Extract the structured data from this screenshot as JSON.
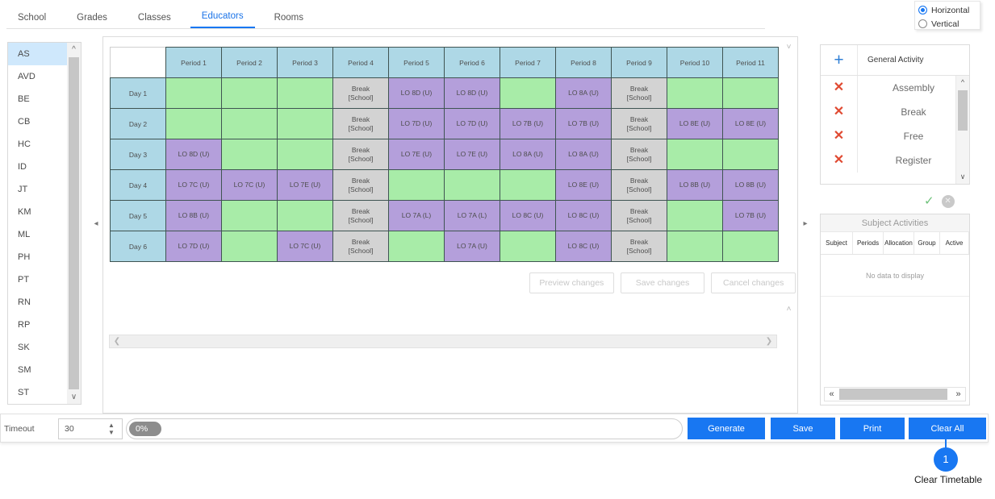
{
  "tabs": [
    {
      "label": "School",
      "active": false
    },
    {
      "label": "Grades",
      "active": false
    },
    {
      "label": "Classes",
      "active": false
    },
    {
      "label": "Educators",
      "active": true
    },
    {
      "label": "Rooms",
      "active": false
    }
  ],
  "orientation": {
    "options": [
      {
        "label": "Horizontal",
        "checked": true
      },
      {
        "label": "Vertical",
        "checked": false
      }
    ]
  },
  "educators": {
    "items": [
      "AS",
      "AVD",
      "BE",
      "CB",
      "HC",
      "ID",
      "JT",
      "KM",
      "ML",
      "PH",
      "PT",
      "RN",
      "RP",
      "SK",
      "SM",
      "ST"
    ],
    "selected": "AS"
  },
  "timetable": {
    "corner_label": "",
    "periods": [
      "Period 1",
      "Period 2",
      "Period 3",
      "Period 4",
      "Period 5",
      "Period 6",
      "Period 7",
      "Period 8",
      "Period 9",
      "Period 10",
      "Period 11"
    ],
    "days": [
      "Day 1",
      "Day 2",
      "Day 3",
      "Day 4",
      "Day 5",
      "Day 6"
    ],
    "break_line1": "Break",
    "break_line2": "[School]",
    "rows": [
      [
        {
          "text": "",
          "type": "free"
        },
        {
          "text": "",
          "type": "free"
        },
        {
          "text": "",
          "type": "free"
        },
        {
          "text": "Break|[School]",
          "type": "break"
        },
        {
          "text": "LO 8D (U)",
          "type": "lesson"
        },
        {
          "text": "LO 8D (U)",
          "type": "lesson"
        },
        {
          "text": "",
          "type": "free"
        },
        {
          "text": "LO 8A (U)",
          "type": "lesson"
        },
        {
          "text": "Break|[School]",
          "type": "break"
        },
        {
          "text": "",
          "type": "free"
        },
        {
          "text": "",
          "type": "free"
        }
      ],
      [
        {
          "text": "",
          "type": "free"
        },
        {
          "text": "",
          "type": "free"
        },
        {
          "text": "",
          "type": "free"
        },
        {
          "text": "Break|[School]",
          "type": "break"
        },
        {
          "text": "LO 7D (U)",
          "type": "lesson"
        },
        {
          "text": "LO 7D (U)",
          "type": "lesson"
        },
        {
          "text": "LO 7B (U)",
          "type": "lesson"
        },
        {
          "text": "LO 7B (U)",
          "type": "lesson"
        },
        {
          "text": "Break|[School]",
          "type": "break"
        },
        {
          "text": "LO 8E (U)",
          "type": "lesson"
        },
        {
          "text": "LO 8E (U)",
          "type": "lesson"
        }
      ],
      [
        {
          "text": "LO 8D (U)",
          "type": "lesson"
        },
        {
          "text": "",
          "type": "free"
        },
        {
          "text": "",
          "type": "free"
        },
        {
          "text": "Break|[School]",
          "type": "break"
        },
        {
          "text": "LO 7E (U)",
          "type": "lesson"
        },
        {
          "text": "LO 7E (U)",
          "type": "lesson"
        },
        {
          "text": "LO 8A (U)",
          "type": "lesson"
        },
        {
          "text": "LO 8A (U)",
          "type": "lesson"
        },
        {
          "text": "Break|[School]",
          "type": "break"
        },
        {
          "text": "",
          "type": "free"
        },
        {
          "text": "",
          "type": "free"
        }
      ],
      [
        {
          "text": "LO 7C (U)",
          "type": "lesson"
        },
        {
          "text": "LO 7C (U)",
          "type": "lesson"
        },
        {
          "text": "LO 7E (U)",
          "type": "lesson"
        },
        {
          "text": "Break|[School]",
          "type": "break"
        },
        {
          "text": "",
          "type": "free"
        },
        {
          "text": "",
          "type": "free"
        },
        {
          "text": "",
          "type": "free"
        },
        {
          "text": "LO 8E (U)",
          "type": "lesson"
        },
        {
          "text": "Break|[School]",
          "type": "break"
        },
        {
          "text": "LO 8B (U)",
          "type": "lesson"
        },
        {
          "text": "LO 8B (U)",
          "type": "lesson"
        }
      ],
      [
        {
          "text": "LO 8B (U)",
          "type": "lesson"
        },
        {
          "text": "",
          "type": "free"
        },
        {
          "text": "",
          "type": "free"
        },
        {
          "text": "Break|[School]",
          "type": "break"
        },
        {
          "text": "LO 7A (L)",
          "type": "lesson"
        },
        {
          "text": "LO 7A (L)",
          "type": "lesson"
        },
        {
          "text": "LO 8C (U)",
          "type": "lesson"
        },
        {
          "text": "LO 8C (U)",
          "type": "lesson"
        },
        {
          "text": "Break|[School]",
          "type": "break"
        },
        {
          "text": "",
          "type": "free"
        },
        {
          "text": "LO 7B (U)",
          "type": "lesson"
        }
      ],
      [
        {
          "text": "LO 7D (U)",
          "type": "lesson"
        },
        {
          "text": "",
          "type": "free"
        },
        {
          "text": "LO 7C (U)",
          "type": "lesson"
        },
        {
          "text": "Break|[School]",
          "type": "break"
        },
        {
          "text": "",
          "type": "free"
        },
        {
          "text": "LO 7A (U)",
          "type": "lesson"
        },
        {
          "text": "",
          "type": "free"
        },
        {
          "text": "LO 8C (U)",
          "type": "lesson"
        },
        {
          "text": "Break|[School]",
          "type": "break"
        },
        {
          "text": "",
          "type": "free"
        },
        {
          "text": "",
          "type": "free"
        }
      ]
    ]
  },
  "change_buttons": [
    {
      "label": "Preview changes"
    },
    {
      "label": "Save changes"
    },
    {
      "label": "Cancel changes"
    }
  ],
  "general_activity": {
    "title": "General Activity",
    "add_icon": "+",
    "remove_icon": "✕",
    "items": [
      "Assembly",
      "Break",
      "Free",
      "Register"
    ],
    "confirm_icon": "✓",
    "cancel_icon": "✕"
  },
  "subject_activities": {
    "title": "Subject Activities",
    "columns": [
      "Subject",
      "Periods",
      "Allocation",
      "Group",
      "Active"
    ],
    "empty_text": "No data to display"
  },
  "bottom": {
    "timeout_label": "Timeout",
    "timeout_value": "30",
    "progress_text": "0%",
    "buttons": [
      {
        "label": "Generate"
      },
      {
        "label": "Save"
      },
      {
        "label": "Print"
      },
      {
        "label": "Clear All"
      }
    ]
  },
  "callout": {
    "number": "1",
    "label": "Clear Timetable"
  },
  "colors": {
    "accent": "#1877f2",
    "free_cell": "#a8eca8",
    "lesson_cell": "#b49fdb",
    "break_cell": "#d3d3d3",
    "header_cell": "#aed8e6",
    "selected_row": "#cfe8fc",
    "remove_icon": "#e04a32"
  }
}
